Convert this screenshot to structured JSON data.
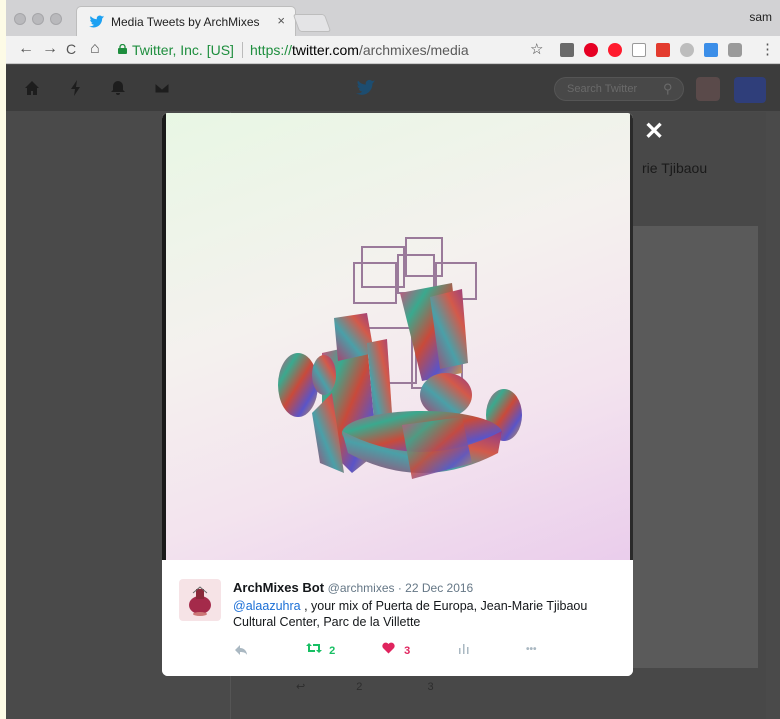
{
  "browser": {
    "tab_title": "Media Tweets by ArchMixes Bo",
    "tab_close": "×",
    "profile_name": "sam",
    "nav": {
      "back": "←",
      "forward": "→",
      "reload": "C",
      "home": "⌂"
    },
    "security_label": "Twitter, Inc. [US]",
    "url_scheme": "https://",
    "url_host": "twitter.com",
    "url_path": "/archmixes/media",
    "bookmark_star": "☆",
    "menu": "⋮"
  },
  "twitter_nav": {
    "search_placeholder": "Search Twitter",
    "search_icon": "⚲"
  },
  "background": {
    "visible_text": "rie Tjibaou",
    "actions": {
      "retweets": "2",
      "likes": "3"
    }
  },
  "modal": {
    "close": "✕",
    "tweet": {
      "name": "ArchMixes Bot",
      "meta": "@archmixes · 22 Dec 2016",
      "mention": "@alaazuhra",
      "text": " , your mix of Puerta de Europa, Jean-Marie Tjibaou Cultural Center, Parc de la Villette",
      "actions": {
        "reply_icon": "reply-icon",
        "retweet_count": "2",
        "like_count": "3",
        "analytics_icon": "analytics-icon",
        "more": "•••"
      }
    }
  },
  "colors": {
    "retweet": "#17bf63",
    "like": "#e0245e",
    "icon_gray": "#aab8c2",
    "link": "#1b6fd6"
  }
}
